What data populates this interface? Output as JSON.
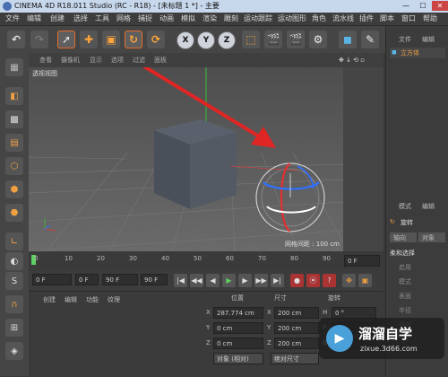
{
  "window": {
    "title": "CINEMA 4D R18.011 Studio (RC - R18) - [未标题 1 *] - 主要"
  },
  "menu": [
    "文件",
    "编辑",
    "创建",
    "选择",
    "工具",
    "网格",
    "捕捉",
    "动画",
    "模拟",
    "渲染",
    "雕刻",
    "运动跟踪",
    "运动图形",
    "角色",
    "流水线",
    "插件",
    "脚本",
    "窗口",
    "帮助"
  ],
  "toolbar": {
    "x": "X",
    "y": "Y",
    "z": "Z"
  },
  "viewport": {
    "menu": [
      "查看",
      "摄像机",
      "显示",
      "选项",
      "过滤",
      "面板"
    ],
    "label": "透视视图",
    "grid_spacing": "网格间距 : 100 cm"
  },
  "timeline": {
    "ticks": [
      "0",
      "10",
      "20",
      "30",
      "40",
      "50",
      "60",
      "70",
      "80",
      "90"
    ],
    "end_frame": "0 F"
  },
  "playback": {
    "start": "0 F",
    "mid": "0 F",
    "end": "90 F",
    "end2": "90 F"
  },
  "material_panel": {
    "menu": [
      "创建",
      "编辑",
      "功能",
      "纹理"
    ]
  },
  "coords": {
    "headers": [
      "位置",
      "尺寸",
      "旋转"
    ],
    "rows": [
      {
        "axis": "X",
        "pos": "287.774 cm",
        "size_axis": "X",
        "size": "200 cm",
        "rot_axis": "H",
        "rot": "0 °"
      },
      {
        "axis": "Y",
        "pos": "0 cm",
        "size_axis": "Y",
        "size": "200 cm",
        "rot_axis": "P",
        "rot": "0 °"
      },
      {
        "axis": "Z",
        "pos": "0 cm",
        "size_axis": "Z",
        "size": "200 cm",
        "rot_axis": "B",
        "rot": "0 °"
      }
    ],
    "mode_select": "对象 (相对)",
    "size_select": "绝对尺寸"
  },
  "right_panel": {
    "tabs": [
      "文件",
      "编辑"
    ],
    "object": "立方体",
    "attr_tabs": [
      "模式",
      "编辑"
    ],
    "attr_title": "旋转",
    "attr_sub": [
      "轴向",
      "对象"
    ],
    "soft_select": "柔和选择",
    "props": [
      "启用",
      "模式",
      "表面",
      "半径",
      "强度"
    ]
  },
  "watermark": {
    "name": "溜溜自学",
    "url": "zixue.3d66.com"
  },
  "colors": {
    "arrow": "#e02525",
    "accent": "#f0a040",
    "highlight": "#e66c2c"
  }
}
